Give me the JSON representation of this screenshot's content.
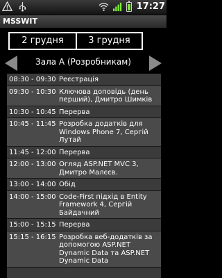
{
  "status": {
    "time": "17:27"
  },
  "app": {
    "title": "MSSWIT"
  },
  "dates": [
    "2 грудня",
    "3 грудня"
  ],
  "hall": "Зала А (Розробникам)",
  "sessions": [
    {
      "time": "08:30 - 09:30",
      "title": "Реєстрація"
    },
    {
      "time": "09:30 - 10:30",
      "title": "Ключова доповідь (день перший), Дмитро Шимків"
    },
    {
      "time": "10:30 - 10:45",
      "title": "Перерва"
    },
    {
      "time": "10:45 - 11:45",
      "title": "Розробка додатків для Windows Phone 7, Сергій Лутай"
    },
    {
      "time": "11:45 - 12:00",
      "title": "Перерва"
    },
    {
      "time": "12:00 - 13:00",
      "title": "Огляд ASP.NET MVC 3, Дмитро Малєєв."
    },
    {
      "time": "13:00 - 14:00",
      "title": "Обід"
    },
    {
      "time": "14:00 - 15:00",
      "title": "Code-First підхід в Entity Framework 4, Сергій Байдачний"
    },
    {
      "time": "15:00 - 15:15",
      "title": "Перерва"
    },
    {
      "time": "15:15 - 16:15",
      "title": "Розробка веб-додатків за допомогою ASP.NET Dynamic Data та ASP.NET Dynamic Data"
    }
  ],
  "icons": {
    "status_left": [
      "warning-icon",
      "usb-icon"
    ],
    "status_right": [
      "wifi-icon",
      "signal-icon",
      "battery-icon"
    ],
    "nav": [
      "arrow-left-icon",
      "arrow-right-icon"
    ]
  }
}
